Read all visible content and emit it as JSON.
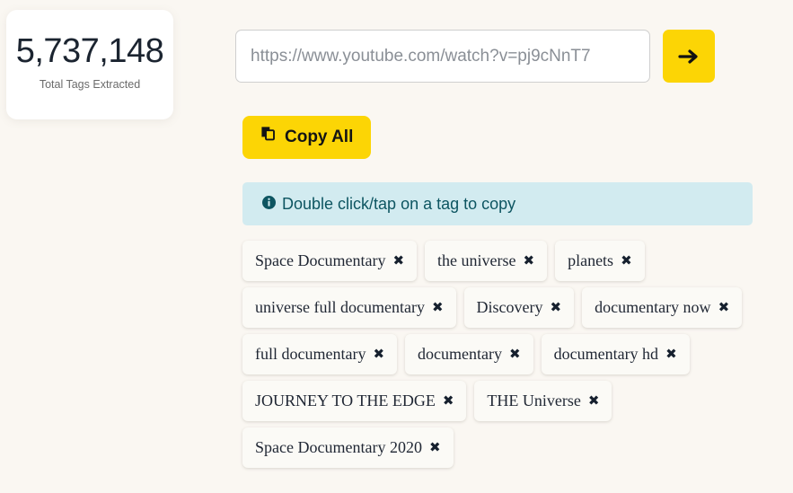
{
  "stat_card": {
    "value": "5,737,148",
    "label": "Total Tags Extracted"
  },
  "url_form": {
    "placeholder": "https://www.youtube.com/watch?v=pj9cNnT7",
    "value": "",
    "submit_icon": "arrow-right-icon"
  },
  "copy_all": {
    "label": "Copy All",
    "icon": "copy-icon"
  },
  "info_banner": {
    "icon": "info-circle-icon",
    "message": "Double click/tap on a tag to copy"
  },
  "tags": {
    "remove_glyph": "✖",
    "items": [
      {
        "label": "Space Documentary"
      },
      {
        "label": "the universe"
      },
      {
        "label": "planets"
      },
      {
        "label": "universe full documentary"
      },
      {
        "label": "Discovery"
      },
      {
        "label": "documentary now"
      },
      {
        "label": "full documentary"
      },
      {
        "label": "documentary"
      },
      {
        "label": "documentary hd"
      },
      {
        "label": "JOURNEY TO THE EDGE"
      },
      {
        "label": "THE Universe"
      },
      {
        "label": "Space Documentary 2020"
      }
    ]
  },
  "colors": {
    "page_background": "#faf7f2",
    "accent_yellow": "#fcd505",
    "info_background": "#d2ebf0",
    "info_text": "#0d5561",
    "card_background": "#ffffff",
    "tag_background": "#fbfaf6",
    "text_dark": "#1b2430"
  }
}
